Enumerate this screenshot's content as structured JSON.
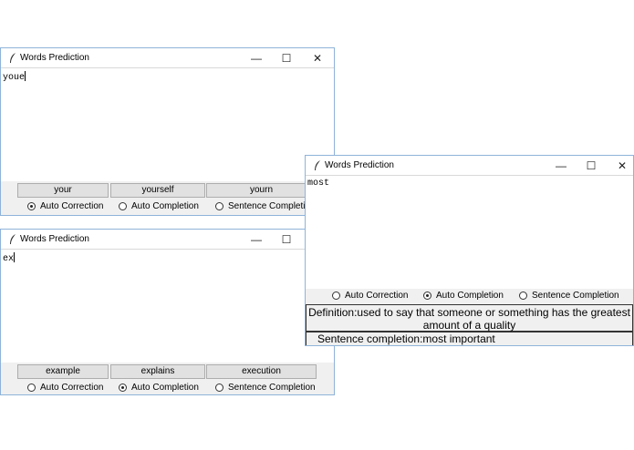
{
  "icons": {
    "app": "feather-icon",
    "minimize": "minimize-icon",
    "maximize": "maximize-icon",
    "close": "close-icon"
  },
  "window1": {
    "title": "Words Prediction",
    "text": "youe",
    "suggestions": [
      "your",
      "yourself",
      "yourn"
    ],
    "radios": [
      {
        "label": "Auto Correction",
        "selected": true
      },
      {
        "label": "Auto Completion",
        "selected": false
      },
      {
        "label": "Sentence Completion",
        "selected": false
      }
    ]
  },
  "window2": {
    "title": "Words Prediction",
    "text": "ex",
    "suggestions": [
      "example",
      "explains",
      "execution"
    ],
    "radios": [
      {
        "label": "Auto Correction",
        "selected": false
      },
      {
        "label": "Auto Completion",
        "selected": true
      },
      {
        "label": "Sentence Completion",
        "selected": false
      }
    ]
  },
  "window3": {
    "title": "Words Prediction",
    "text": "most",
    "radios": [
      {
        "label": "Auto Correction",
        "selected": false
      },
      {
        "label": "Auto Completion",
        "selected": true
      },
      {
        "label": "Sentence Completion",
        "selected": false
      }
    ],
    "definition": "Definition:used to say that someone or something has the greatest amount of a quality",
    "sentence_completion": "Sentence completion:most important"
  }
}
